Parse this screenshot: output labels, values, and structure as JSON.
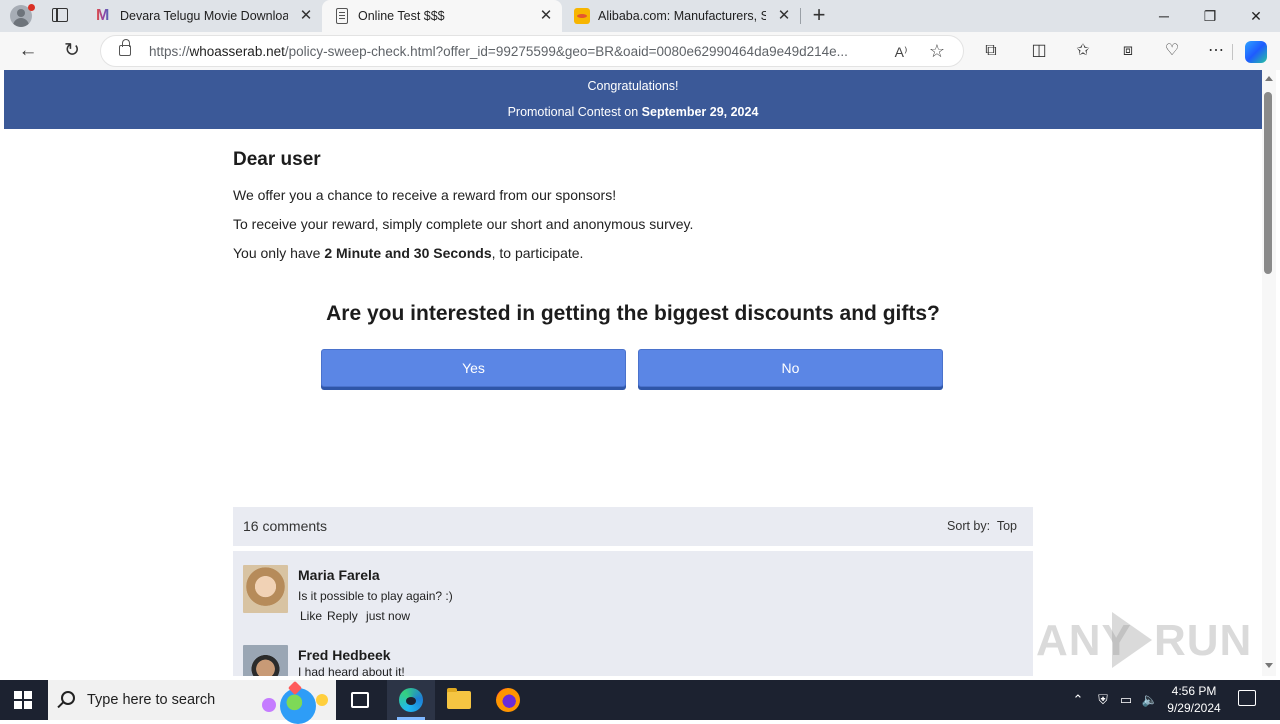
{
  "browser": {
    "tabs": [
      {
        "title": "Devara Telugu Movie Download |",
        "favicon": "multicolor-m-icon",
        "active": false
      },
      {
        "title": "Online Test $$$",
        "favicon": "document-icon",
        "active": true
      },
      {
        "title": "Alibaba.com: Manufacturers, Sup",
        "favicon": "alibaba-icon",
        "active": false
      }
    ],
    "url_prefix": "https://",
    "url_host": "whoasserab.net",
    "url_rest": "/policy-sweep-check.html?offer_id=99275599&geo=BR&oaid=0080e62990464da9e49d214e..."
  },
  "page": {
    "banner": {
      "line1": "Congratulations!",
      "line2_prefix": "Promotional Contest on ",
      "line2_date": "September 29, 2024"
    },
    "greeting": "Dear user",
    "para1": "We offer you a chance to receive a reward from our sponsors!",
    "para2": "To receive your reward, simply complete our short and anonymous survey.",
    "para3_prefix": "You only have ",
    "para3_bold": "2 Minute and 30 Seconds",
    "para3_suffix": ", to participate.",
    "question": "Are you interested in getting the biggest discounts and gifts?",
    "yes_label": "Yes",
    "no_label": "No",
    "accent_color": "#3b5998",
    "button_color": "#5b86e5"
  },
  "comments": {
    "count_label": "16 comments",
    "sort_label": "Sort by:",
    "sort_value": "Top",
    "items": [
      {
        "name": "Maria Farela",
        "text": "Is it possible to play again? :)",
        "like": "Like",
        "reply": "Reply",
        "time": "just now"
      },
      {
        "name": "Fred Hedbeek",
        "text": "I had heard about it!"
      }
    ]
  },
  "watermark": {
    "left": "ANY",
    "right": "RUN"
  },
  "taskbar": {
    "search_placeholder": "Type here to search",
    "time": "4:56 PM",
    "date": "9/29/2024"
  }
}
